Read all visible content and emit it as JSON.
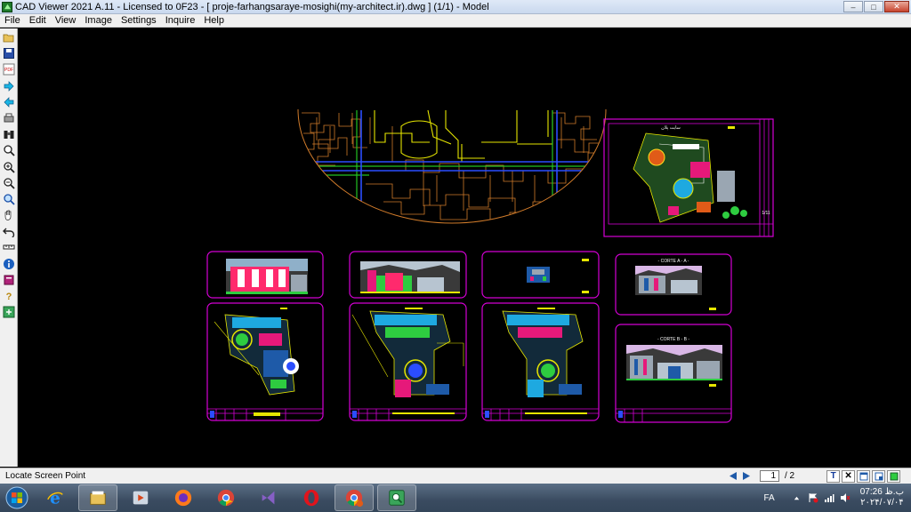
{
  "window": {
    "title": "CAD Viewer 2021 A.11  -  Licensed to 0F23  -  [ proje-farhangsaraye-mosighi(my-architect.ir).dwg ] (1/1)  -  Model",
    "minimize": "‒",
    "maximize": "□",
    "close": "✕"
  },
  "menu": [
    "File",
    "Edit",
    "View",
    "Image",
    "Settings",
    "Inquire",
    "Help"
  ],
  "toolbar": {
    "icons": [
      "open-folder-icon",
      "save-disk-icon",
      "pdf-export-icon",
      "next-arrow-icon",
      "back-arrow-icon",
      "print-icon",
      "binoculars-icon",
      "zoom-icon",
      "zoom-in-icon",
      "zoom-out-icon",
      "zoom-window-icon",
      "pan-hand-icon",
      "undo-icon",
      "measure-icon",
      "info-icon",
      "layers-book-icon",
      "help-icon",
      "convert-icon"
    ],
    "pdf_label": "PDF"
  },
  "drawing": {
    "sheet_titles": {
      "site": "سایت پلان",
      "section_a": "- CORTE A - A -",
      "section_b": "- CORTE B - B -",
      "scale": "1/11"
    },
    "colors": {
      "frame": "#d400d4",
      "site_lines": "#d07b2a",
      "yellow": "#e6e600",
      "green": "#22c322",
      "blue": "#2b4dff",
      "cyan": "#00e0e0"
    }
  },
  "status": {
    "text": "Locate Screen Point",
    "page_current": "1",
    "page_total": "/ 2",
    "text_tool": "T",
    "close_tool": "✕"
  },
  "taskbar": {
    "apps": [
      "explorer-icon",
      "internet-explorer-icon",
      "file-manager-icon",
      "media-player-icon",
      "firefox-icon",
      "chrome-icon",
      "visual-studio-icon",
      "opera-icon",
      "chrome-profile-icon",
      "cad-viewer-icon"
    ],
    "lang": "FA",
    "time": "07:26 ب.ظ",
    "date": "۲۰۲۴/۰۷/۰۴"
  }
}
